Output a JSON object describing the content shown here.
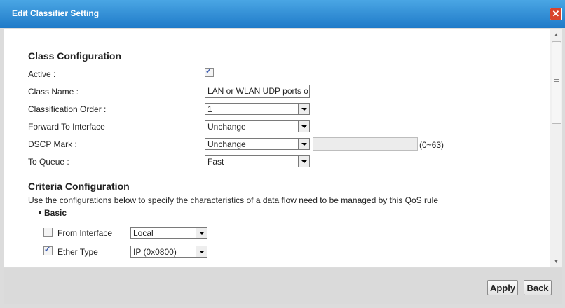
{
  "dialog": {
    "title": "Edit Classifier Setting",
    "close_symbol": "✕"
  },
  "class_config": {
    "heading": "Class Configuration",
    "active_label": "Active :",
    "active_checked": true,
    "class_name_label": "Class Name :",
    "class_name_value": "LAN or WLAN UDP ports o",
    "classification_order_label": "Classification Order :",
    "classification_order_value": "1",
    "forward_label": "Forward To Interface",
    "forward_value": "Unchange",
    "dscp_label": "DSCP Mark :",
    "dscp_value": "Unchange",
    "dscp_input_value": "",
    "dscp_range": "(0~63)",
    "queue_label": "To Queue :",
    "queue_value": "Fast"
  },
  "criteria": {
    "heading": "Criteria Configuration",
    "description": "Use the configurations below to specify the characteristics of a data flow need to be managed by this QoS rule",
    "basic_label": "Basic",
    "from_interface_label": "From Interface",
    "from_interface_checked": false,
    "from_interface_value": "Local",
    "ether_type_label": "Ether Type",
    "ether_type_checked": true,
    "ether_type_value": "IP (0x0800)"
  },
  "footer": {
    "apply_label": "Apply",
    "back_label": "Back"
  }
}
